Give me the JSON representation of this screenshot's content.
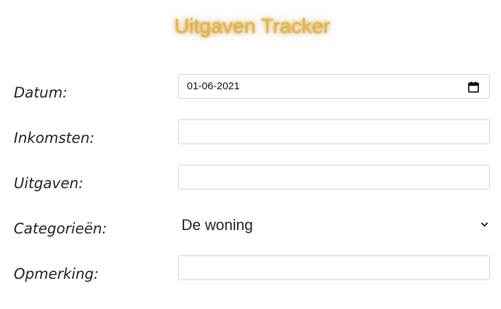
{
  "header": {
    "title": "Uitgaven Tracker",
    "title_color": "#f0b429"
  },
  "form": {
    "datum": {
      "label": "Datum:",
      "value": "01-06-2021",
      "icon": "calendar-icon"
    },
    "inkomsten": {
      "label": "Inkomsten:",
      "value": ""
    },
    "uitgaven": {
      "label": "Uitgaven:",
      "value": ""
    },
    "categorieen": {
      "label": "Categorieën:",
      "selected": "De woning",
      "icon": "chevron-down-icon"
    },
    "opmerking": {
      "label": "Opmerking:",
      "value": ""
    }
  }
}
